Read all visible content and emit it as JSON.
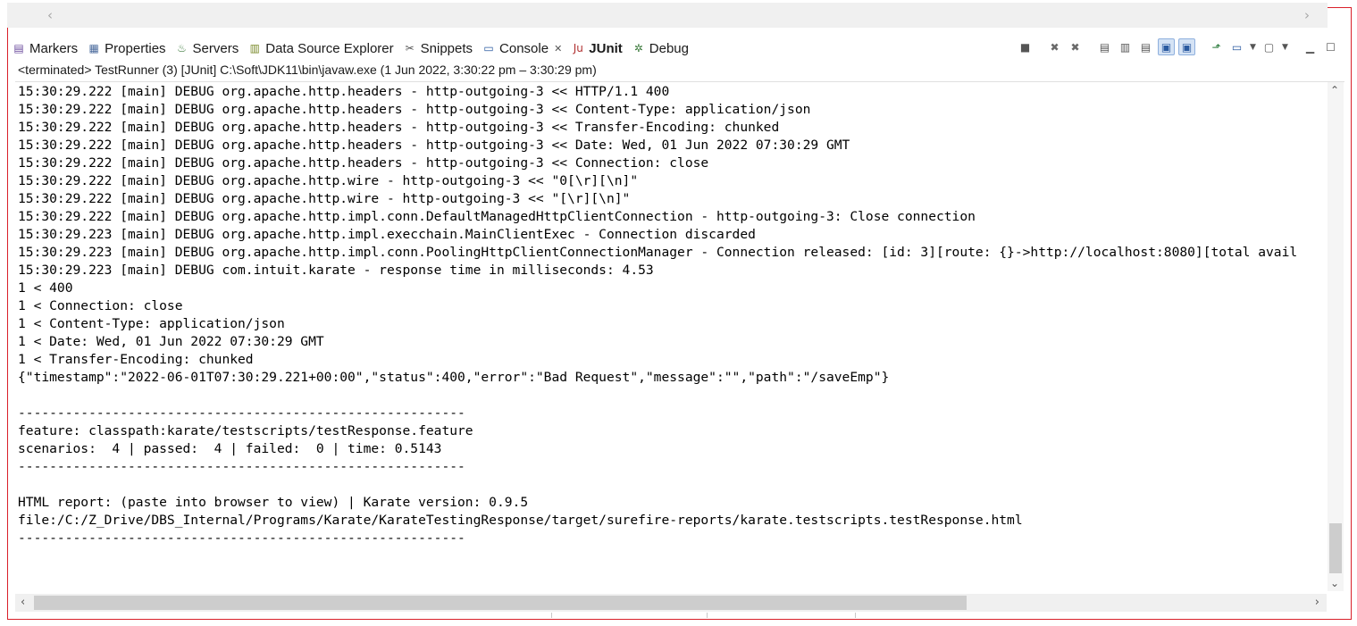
{
  "tabs": [
    {
      "label": "Markers",
      "icon": "markers-icon",
      "glyph": "▤",
      "color": "#6a4a9c"
    },
    {
      "label": "Properties",
      "icon": "properties-icon",
      "glyph": "▦",
      "color": "#4a6a9c"
    },
    {
      "label": "Servers",
      "icon": "servers-icon",
      "glyph": "♨",
      "color": "#3c7a3c"
    },
    {
      "label": "Data Source Explorer",
      "icon": "data-source-icon",
      "glyph": "▥",
      "color": "#7a8a2a"
    },
    {
      "label": "Snippets",
      "icon": "snippets-icon",
      "glyph": "✂",
      "color": "#555555"
    },
    {
      "label": "Console",
      "icon": "console-icon",
      "glyph": "▭",
      "color": "#2a5aa0"
    },
    {
      "label": "JUnit",
      "icon": "junit-icon",
      "glyph": "Ju",
      "color": "#b03030"
    },
    {
      "label": "Debug",
      "icon": "debug-icon",
      "glyph": "✲",
      "color": "#3c7a3c"
    }
  ],
  "active_tab": "Console",
  "status_line": "<terminated> TestRunner (3) [JUnit] C:\\Soft\\JDK11\\bin\\javaw.exe  (1 Jun 2022, 3:30:22 pm – 3:30:29 pm)",
  "toolbar": [
    {
      "name": "terminate-icon",
      "glyph": "■"
    },
    {
      "name": "remove-launch-icon",
      "glyph": "✖"
    },
    {
      "name": "remove-all-terminated-icon",
      "glyph": "✖"
    },
    {
      "name": "clear-console-icon",
      "glyph": "▤"
    },
    {
      "name": "scroll-lock-icon",
      "glyph": "▥"
    },
    {
      "name": "word-wrap-icon",
      "glyph": "▤"
    },
    {
      "name": "show-stdout-icon",
      "glyph": "▣"
    },
    {
      "name": "show-stderr-icon",
      "glyph": "▣"
    },
    {
      "name": "pin-console-icon",
      "glyph": "⬏"
    },
    {
      "name": "display-console-icon",
      "glyph": "▭"
    },
    {
      "name": "open-console-icon",
      "glyph": "▢"
    },
    {
      "name": "minimize-icon",
      "glyph": "▁"
    },
    {
      "name": "maximize-icon",
      "glyph": "☐"
    }
  ],
  "console_lines": [
    "15:30:29.222 [main] DEBUG org.apache.http.headers - http-outgoing-3 << HTTP/1.1 400",
    "15:30:29.222 [main] DEBUG org.apache.http.headers - http-outgoing-3 << Content-Type: application/json",
    "15:30:29.222 [main] DEBUG org.apache.http.headers - http-outgoing-3 << Transfer-Encoding: chunked",
    "15:30:29.222 [main] DEBUG org.apache.http.headers - http-outgoing-3 << Date: Wed, 01 Jun 2022 07:30:29 GMT",
    "15:30:29.222 [main] DEBUG org.apache.http.headers - http-outgoing-3 << Connection: close",
    "15:30:29.222 [main] DEBUG org.apache.http.wire - http-outgoing-3 << \"0[\\r][\\n]\"",
    "15:30:29.222 [main] DEBUG org.apache.http.wire - http-outgoing-3 << \"[\\r][\\n]\"",
    "15:30:29.222 [main] DEBUG org.apache.http.impl.conn.DefaultManagedHttpClientConnection - http-outgoing-3: Close connection",
    "15:30:29.223 [main] DEBUG org.apache.http.impl.execchain.MainClientExec - Connection discarded",
    "15:30:29.223 [main] DEBUG org.apache.http.impl.conn.PoolingHttpClientConnectionManager - Connection released: [id: 3][route: {}->http://localhost:8080][total avail",
    "15:30:29.223 [main] DEBUG com.intuit.karate - response time in milliseconds: 4.53",
    "1 < 400",
    "1 < Connection: close",
    "1 < Content-Type: application/json",
    "1 < Date: Wed, 01 Jun 2022 07:30:29 GMT",
    "1 < Transfer-Encoding: chunked",
    "{\"timestamp\":\"2022-06-01T07:30:29.221+00:00\",\"status\":400,\"error\":\"Bad Request\",\"message\":\"\",\"path\":\"/saveEmp\"}",
    "",
    "---------------------------------------------------------",
    "feature: classpath:karate/testscripts/testResponse.feature",
    "scenarios:  4 | passed:  4 | failed:  0 | time: 0.5143",
    "---------------------------------------------------------",
    "",
    "HTML report: (paste into browser to view) | Karate version: 0.9.5",
    "file:/C:/Z_Drive/DBS_Internal/Programs/Karate/KarateTestingResponse/target/surefire-reports/karate.testscripts.testResponse.html",
    "---------------------------------------------------------"
  ]
}
